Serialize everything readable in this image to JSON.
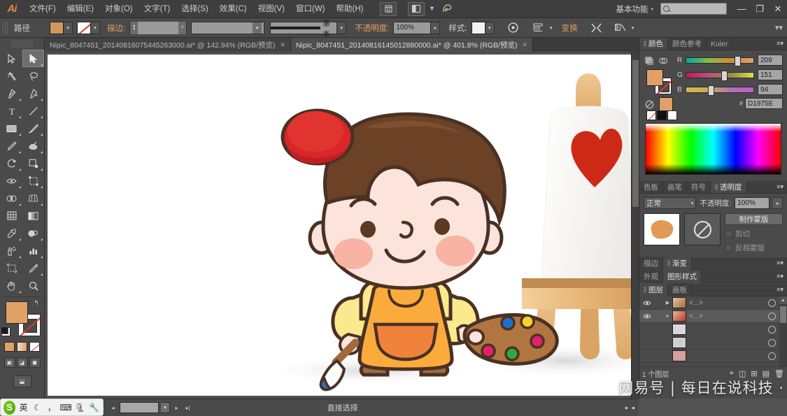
{
  "app": {
    "name": "Adobe Illustrator",
    "logo": "Ai"
  },
  "menubar": {
    "items": [
      {
        "label": "文件(F)",
        "name": "menu-file"
      },
      {
        "label": "编辑(E)",
        "name": "menu-edit"
      },
      {
        "label": "对象(O)",
        "name": "menu-object"
      },
      {
        "label": "文字(T)",
        "name": "menu-type"
      },
      {
        "label": "选择(S)",
        "name": "menu-select"
      },
      {
        "label": "效果(C)",
        "name": "menu-effect"
      },
      {
        "label": "视图(V)",
        "name": "menu-view"
      },
      {
        "label": "窗口(W)",
        "name": "menu-window"
      },
      {
        "label": "帮助(H)",
        "name": "menu-help"
      }
    ],
    "bridge_icon": "bridge-icon",
    "arrange_icon": "arrange-documents-icon",
    "arrange_caret": "▾",
    "stock_icon": "stock-photos-icon",
    "workspace": "基本功能",
    "workspace_caret": "▾",
    "search_placeholder": "",
    "search_value": "",
    "minimize": "—",
    "restore": "❐",
    "close": "✕"
  },
  "controlbar": {
    "selection_label": "路径",
    "fill_swatch_color": "#d1975e",
    "fill_caret": "▾",
    "stroke_swatch": "none",
    "stroke_caret": "▾",
    "stroke_label": "描边:",
    "stroke_weight": "",
    "stroke_weight_caret": "▾",
    "stroke_style": "",
    "stroke_style_caret": "▾",
    "stroke_profile_label": "基本",
    "stroke_profile_caret": "▾",
    "opacity_label": "不透明度:",
    "opacity_value": "100%",
    "opacity_caret": "▸",
    "styles_label": "样式:",
    "styles_caret": "▾",
    "recolor_icon": "recolor-artwork-icon",
    "align_icon": "align-icon",
    "align_caret": "▾",
    "transform_label": "变换",
    "isolate_icon": "isolate-group-icon",
    "mask_icon": "draw-mode-icon",
    "mask_caret": "▾",
    "overflow_caret": "▾▾"
  },
  "tabs": [
    {
      "label": "Nipic_8047451_20140816075445263000.ai* @ 142.94% (RGB/预览)",
      "close": "✕",
      "active": false,
      "name": "document-tab-1"
    },
    {
      "label": "Nipic_8047451_20140816145012880000.ai* @ 401.8% (RGB/预览)",
      "close": "✕",
      "active": true,
      "name": "document-tab-2"
    }
  ],
  "toolbar": {
    "tools": [
      {
        "name": "selection-tool",
        "icon": "arrow",
        "sel": false,
        "corner": false
      },
      {
        "name": "direct-selection-tool",
        "icon": "arrow-white",
        "sel": true,
        "corner": true
      },
      {
        "name": "magic-wand-tool",
        "icon": "wand",
        "sel": false,
        "corner": false
      },
      {
        "name": "lasso-tool",
        "icon": "lasso",
        "sel": false,
        "corner": false
      },
      {
        "name": "pen-tool",
        "icon": "pen",
        "sel": false,
        "corner": true
      },
      {
        "name": "add-anchor-point-tool",
        "icon": "pen-plus",
        "sel": false,
        "corner": true
      },
      {
        "name": "type-tool",
        "icon": "type-T",
        "sel": false,
        "corner": true
      },
      {
        "name": "line-segment-tool",
        "icon": "line",
        "sel": false,
        "corner": true
      },
      {
        "name": "rectangle-tool",
        "icon": "rect",
        "sel": false,
        "corner": true
      },
      {
        "name": "paintbrush-tool",
        "icon": "brush",
        "sel": false,
        "corner": true
      },
      {
        "name": "pencil-tool",
        "icon": "pencil",
        "sel": false,
        "corner": true
      },
      {
        "name": "blob-brush-tool",
        "icon": "blob",
        "sel": false,
        "corner": true
      },
      {
        "name": "rotate-tool",
        "icon": "rotate",
        "sel": false,
        "corner": true
      },
      {
        "name": "scale-tool",
        "icon": "scale",
        "sel": false,
        "corner": true
      },
      {
        "name": "width-tool",
        "icon": "width",
        "sel": false,
        "corner": true
      },
      {
        "name": "free-transform-tool",
        "icon": "free-xform",
        "sel": false,
        "corner": true
      },
      {
        "name": "shape-builder-tool",
        "icon": "shape-builder",
        "sel": false,
        "corner": true
      },
      {
        "name": "perspective-grid-tool",
        "icon": "perspective",
        "sel": false,
        "corner": true
      },
      {
        "name": "mesh-tool",
        "icon": "mesh",
        "sel": false,
        "corner": false
      },
      {
        "name": "gradient-tool",
        "icon": "gradient",
        "sel": false,
        "corner": false
      },
      {
        "name": "eyedropper-tool",
        "icon": "eyedropper",
        "sel": false,
        "corner": true
      },
      {
        "name": "blend-tool",
        "icon": "blend",
        "sel": false,
        "corner": true
      },
      {
        "name": "symbol-sprayer-tool",
        "icon": "symbol-spray",
        "sel": false,
        "corner": true
      },
      {
        "name": "column-graph-tool",
        "icon": "bar-graph",
        "sel": false,
        "corner": true
      },
      {
        "name": "artboard-tool",
        "icon": "artboard",
        "sel": false,
        "corner": false
      },
      {
        "name": "slice-tool",
        "icon": "slice",
        "sel": false,
        "corner": true
      },
      {
        "name": "hand-tool",
        "icon": "hand",
        "sel": false,
        "corner": true
      },
      {
        "name": "zoom-tool",
        "icon": "magnifier",
        "sel": false,
        "corner": false
      }
    ],
    "fill_color": "#e0a068",
    "stroke_color": "none",
    "swap_icon": "↰",
    "mode_buttons": [
      "color-fill-button",
      "gradient-fill-button",
      "none-fill-button"
    ],
    "screen_modes": [
      "normal-screen-mode",
      "full-screen-menu-mode",
      "full-screen-mode"
    ]
  },
  "color_panel": {
    "tabs": [
      {
        "label": "颜色",
        "active": true,
        "name": "panel-tab-color"
      },
      {
        "label": "颜色参考",
        "active": false,
        "name": "panel-tab-color-guide"
      },
      {
        "label": "Kuler",
        "active": false,
        "name": "panel-tab-kuler"
      }
    ],
    "menu_icon": "panel-menu-icon",
    "channels": [
      {
        "label": "R",
        "value": "209",
        "pos": 72
      },
      {
        "label": "G",
        "value": "151",
        "pos": 52
      },
      {
        "label": "B",
        "value": "94",
        "pos": 32
      }
    ],
    "hex_hash": "#",
    "hex_value": "D1975E",
    "fill_color": "#e0a068"
  },
  "transparency_panel": {
    "tabs": [
      {
        "label": "色板",
        "active": false,
        "name": "panel-tab-swatches"
      },
      {
        "label": "画笔",
        "active": false,
        "name": "panel-tab-brushes"
      },
      {
        "label": "符号",
        "active": false,
        "name": "panel-tab-symbols"
      },
      {
        "label": "透明度",
        "active": true,
        "name": "panel-tab-transparency"
      }
    ],
    "menu_icon": "panel-menu-icon",
    "blend_mode": "正常",
    "blend_caret": "▾",
    "opacity_label": "不透明度:",
    "opacity_value": "100%",
    "opacity_caret": "▸",
    "make_mask_label": "制作蒙版",
    "clip_label": "剪切",
    "invert_label": "反相蒙版"
  },
  "collapsed_panels": [
    {
      "name": "stroke-gradient-bar",
      "tabs": [
        {
          "label": "描边",
          "active": false,
          "name": "panel-tab-stroke"
        },
        {
          "label": "渐变",
          "active": true,
          "name": "panel-tab-gradient"
        }
      ]
    },
    {
      "name": "appearance-styles-bar",
      "tabs": [
        {
          "label": "外观",
          "active": false,
          "name": "panel-tab-appearance"
        },
        {
          "label": "图形样式",
          "active": true,
          "name": "panel-tab-graphic-styles"
        }
      ]
    },
    {
      "name": "layers-artboards-bar",
      "tabs": [
        {
          "label": "图层",
          "active": true,
          "name": "panel-tab-layers"
        },
        {
          "label": "画板",
          "active": false,
          "name": "panel-tab-artboards"
        }
      ]
    }
  ],
  "layers_panel": {
    "rows": [
      {
        "name": "layer-row-1",
        "label": "<...>",
        "expanded": true,
        "selected": false
      },
      {
        "name": "layer-row-2",
        "label": "<...>",
        "expanded": false,
        "selected": true
      },
      {
        "name": "layer-row-3",
        "label": "",
        "expanded": false,
        "selected": false
      },
      {
        "name": "layer-row-4",
        "label": "",
        "expanded": false,
        "selected": false
      },
      {
        "name": "layer-row-5",
        "label": "",
        "expanded": false,
        "selected": false
      },
      {
        "name": "layer-row-6",
        "label": "",
        "expanded": false,
        "selected": false
      }
    ],
    "footer_count": "1 个图层",
    "footer_icons": [
      "locate-object-icon",
      "make-clipping-mask-icon",
      "new-sublayer-icon",
      "new-layer-icon",
      "delete-layer-icon"
    ]
  },
  "statusbar": {
    "zoom_value": "",
    "zoom_caret": "▾",
    "nav_first": "|◂",
    "nav_prev": "◂",
    "artboard_value": "",
    "artboard_caret": "▾",
    "nav_next": "▸",
    "nav_last": "▸|",
    "status_text": "直接选择",
    "right_caret_1": "▸",
    "right_caret_2": "◂"
  },
  "ime": {
    "logo": "S",
    "mode_label": "英",
    "icons": [
      "moon-icon",
      "comma-icon",
      "keyboard-icon",
      "toolbox-icon",
      "wrench-icon"
    ]
  },
  "watermark": {
    "text": "网易号 | 每日在说科技 ·"
  },
  "artwork": {
    "description": "cartoon-boy-painter-with-easel",
    "colors": {
      "beret": "#d9262a",
      "hair": "#6b4226",
      "skin": "#fce4dc",
      "cheek": "#f8b3a2",
      "shirt": "#fbe98e",
      "apron": "#fbab3c",
      "pocket": "#f0823c",
      "pants": "#3a5ba0",
      "shoe": "#a06a3e",
      "palette": "#b07540",
      "easel_wood": "#e8b878",
      "easel_shelf": "#e8b878",
      "canvas": "#ffffff",
      "heart": "#cc2a16",
      "outline": "#4a3123"
    }
  }
}
